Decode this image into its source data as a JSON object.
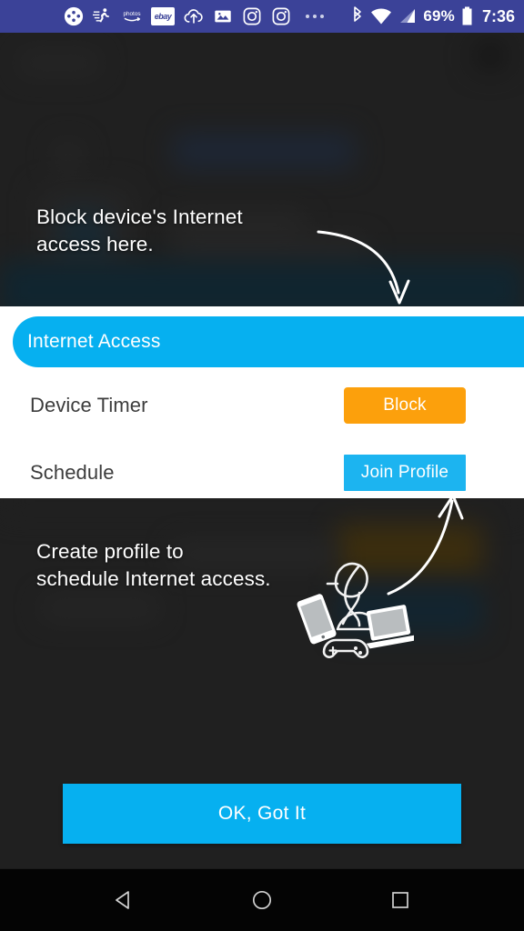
{
  "statusbar": {
    "icons": [
      {
        "name": "puzzle-app-icon",
        "label": ""
      },
      {
        "name": "running-fitness-icon",
        "label": ""
      },
      {
        "name": "amazon-photos-icon",
        "label": "photos"
      },
      {
        "name": "ebay-icon",
        "label": "ebay"
      },
      {
        "name": "cloud-upload-icon",
        "label": ""
      },
      {
        "name": "gallery-image-icon",
        "label": ""
      },
      {
        "name": "instagram-icon",
        "label": ""
      },
      {
        "name": "instagram-icon-2",
        "label": ""
      },
      {
        "name": "overflow-dots-icon",
        "label": ""
      }
    ],
    "bluetooth": "bluetooth-icon",
    "wifi": "wifi-icon",
    "signal": "cell-signal-icon",
    "battery_percent": "69%",
    "battery_icon": "battery-icon",
    "time": "7:36",
    "bar_color": "#3b4298"
  },
  "coach": {
    "top_line1": "Block device's Internet",
    "top_line2": "access here.",
    "bottom_line1": "Create profile to",
    "bottom_line2": "schedule Internet access."
  },
  "card": {
    "pill_label": "Internet Access",
    "pill_color": "#06b0f0",
    "rows": [
      {
        "label": "Device Timer",
        "button": "Block",
        "button_color": "#fca00c"
      },
      {
        "label": "Schedule",
        "button": "Join Profile",
        "button_color": "#1cb4f0"
      }
    ]
  },
  "footer": {
    "ok_label": "OK, Got It",
    "ok_color": "#06b0f0"
  },
  "navbar": {
    "back": "back-triangle-icon",
    "home": "home-circle-icon",
    "recents": "recents-square-icon"
  },
  "illustration": {
    "name": "profile-devices-illustration",
    "parts": [
      "person-figure",
      "smartphone",
      "game-controller",
      "laptop"
    ]
  }
}
